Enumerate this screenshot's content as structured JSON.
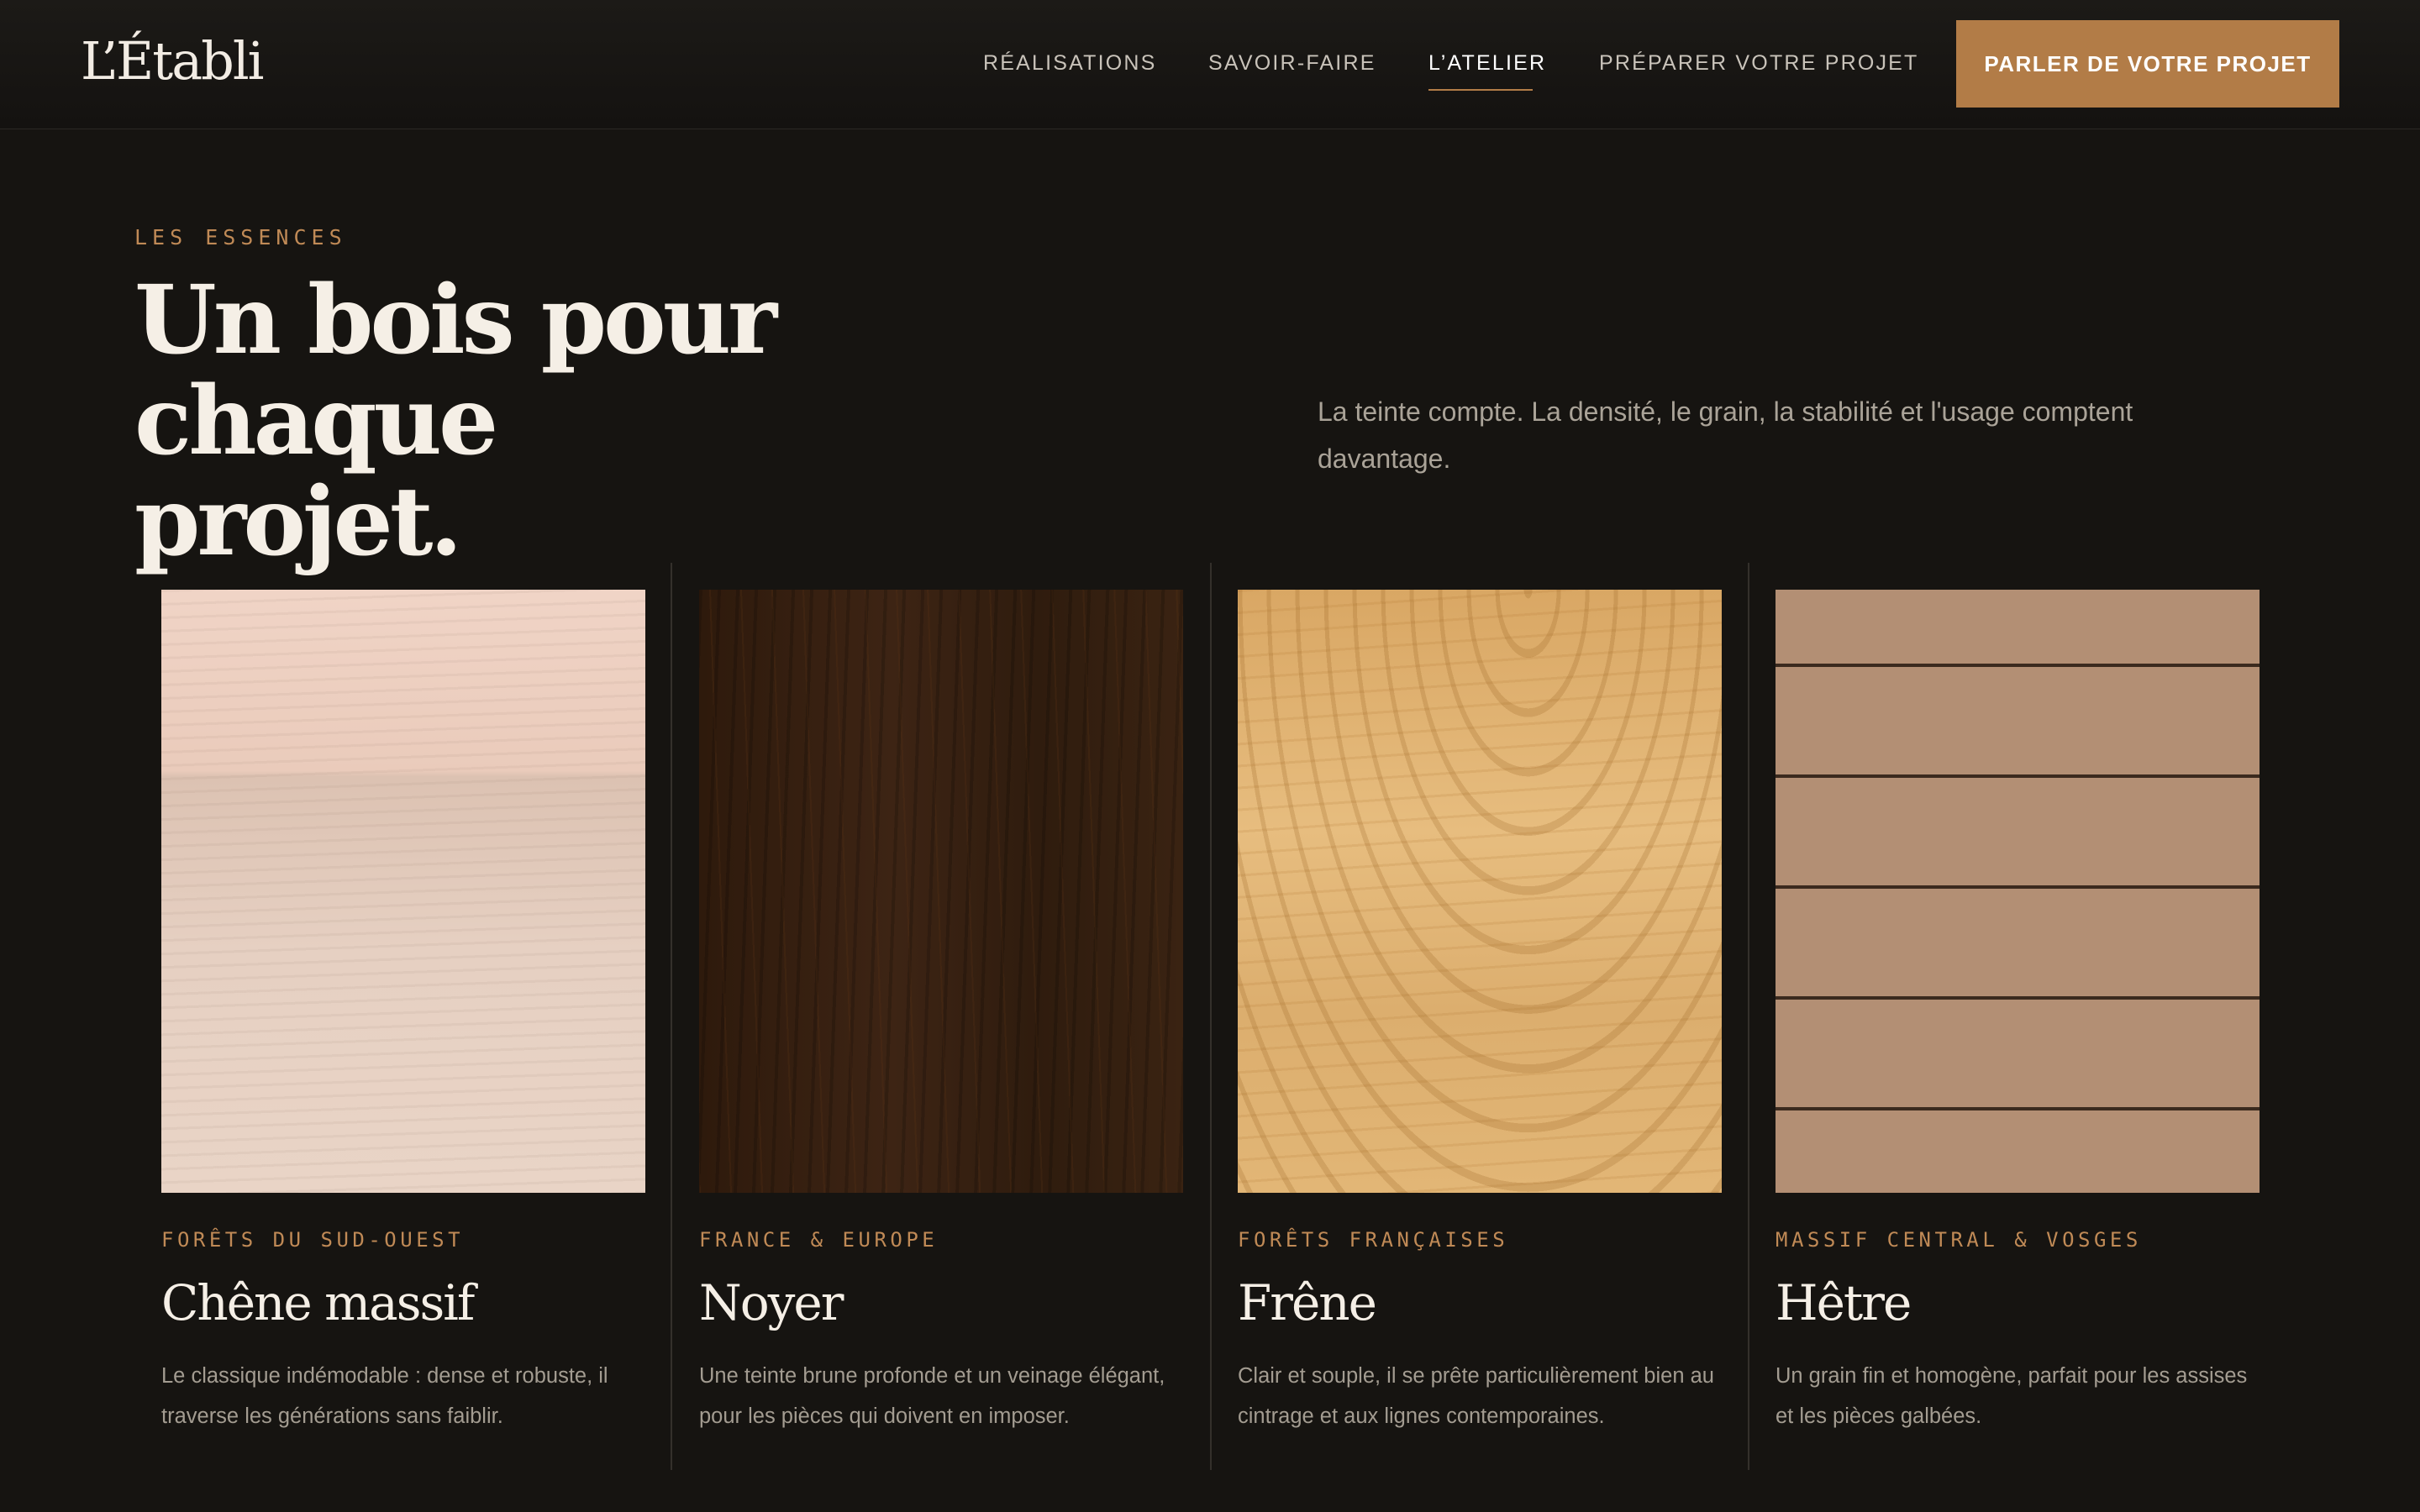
{
  "header": {
    "logo": "L’Établi",
    "nav": [
      {
        "label": "RÉALISATIONS",
        "active": false
      },
      {
        "label": "SAVOIR-FAIRE",
        "active": false
      },
      {
        "label": "L’ATELIER",
        "active": true
      },
      {
        "label": "PRÉPARER VOTRE PROJET",
        "active": false
      }
    ],
    "cta_label": "PARLER DE VOTRE PROJET"
  },
  "intro": {
    "eyebrow": "LES ESSENCES",
    "title_line1": "Un bois pour chaque",
    "title_line2": "projet.",
    "description": "La teinte compte. La densité, le grain, la stabilité et l'usage comptent davantage."
  },
  "woods": [
    {
      "origin": "FORÊTS DU SUD-OUEST",
      "name": "Chêne massif",
      "description": "Le classique indémodable : dense et robuste, il traverse les générations sans faiblir."
    },
    {
      "origin": "FRANCE & EUROPE",
      "name": "Noyer",
      "description": "Une teinte brune profonde et un veinage élégant, pour les pièces qui doivent en imposer."
    },
    {
      "origin": "FORÊTS FRANÇAISES",
      "name": "Frêne",
      "description": "Clair et souple, il se prête particulièrement bien au cintrage et aux lignes contemporaines."
    },
    {
      "origin": "MASSIF CENTRAL & VOSGES",
      "name": "Hêtre",
      "description": "Un grain fin et homogène, parfait pour les assises et les pièces galbées."
    }
  ],
  "colors": {
    "background": "#161411",
    "accent": "#b27c47",
    "eyebrow": "#c08a56"
  }
}
